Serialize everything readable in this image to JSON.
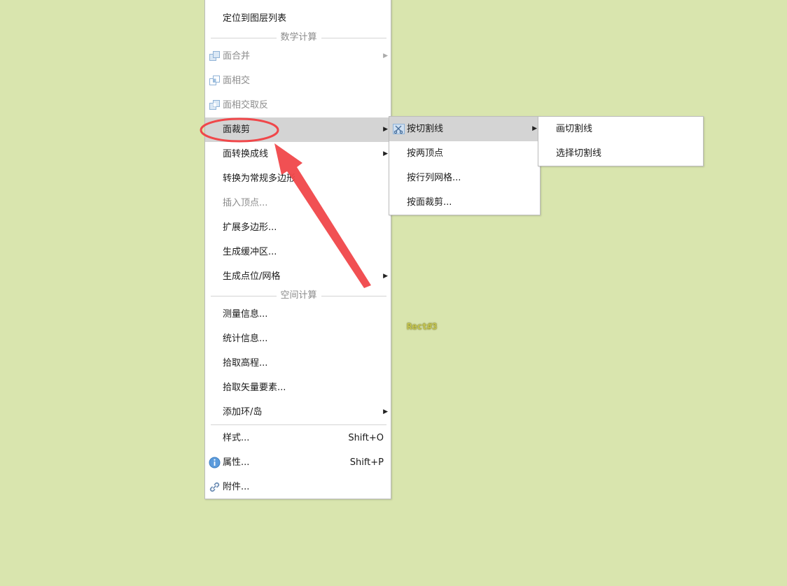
{
  "main_menu": {
    "locate_layer": "定位到图层列表",
    "section_math": "数学计算",
    "merge": "面合并",
    "intersect": "面相交",
    "intersect_invert": "面相交取反",
    "clip": "面裁剪",
    "to_lines": "面转换成线",
    "to_regular": "转换为常规多边形",
    "insert_vertex": "插入顶点...",
    "expand": "扩展多边形...",
    "buffer": "生成缓冲区...",
    "points_grid": "生成点位/网格",
    "section_spatial": "空间计算",
    "measure": "测量信息...",
    "stats": "统计信息...",
    "pick_elevation": "拾取高程...",
    "pick_vector": "拾取矢量要素...",
    "add_ring": "添加环/岛",
    "style": "样式...",
    "style_shortcut": "Shift+O",
    "props": "属性...",
    "props_shortcut": "Shift+P",
    "attachments": "附件..."
  },
  "clip_submenu": {
    "by_cutline": "按切割线",
    "by_two_vertices": "按两顶点",
    "by_grid": "按行列网格...",
    "by_polygon": "按面裁剪..."
  },
  "cutline_submenu": {
    "draw": "画切割线",
    "select": "选择切割线"
  },
  "canvas": {
    "feature_label": "Rect#3"
  },
  "colors": {
    "background": "#d9e5ae",
    "highlight": "#d4d4d4",
    "annotation": "#f0474a"
  }
}
